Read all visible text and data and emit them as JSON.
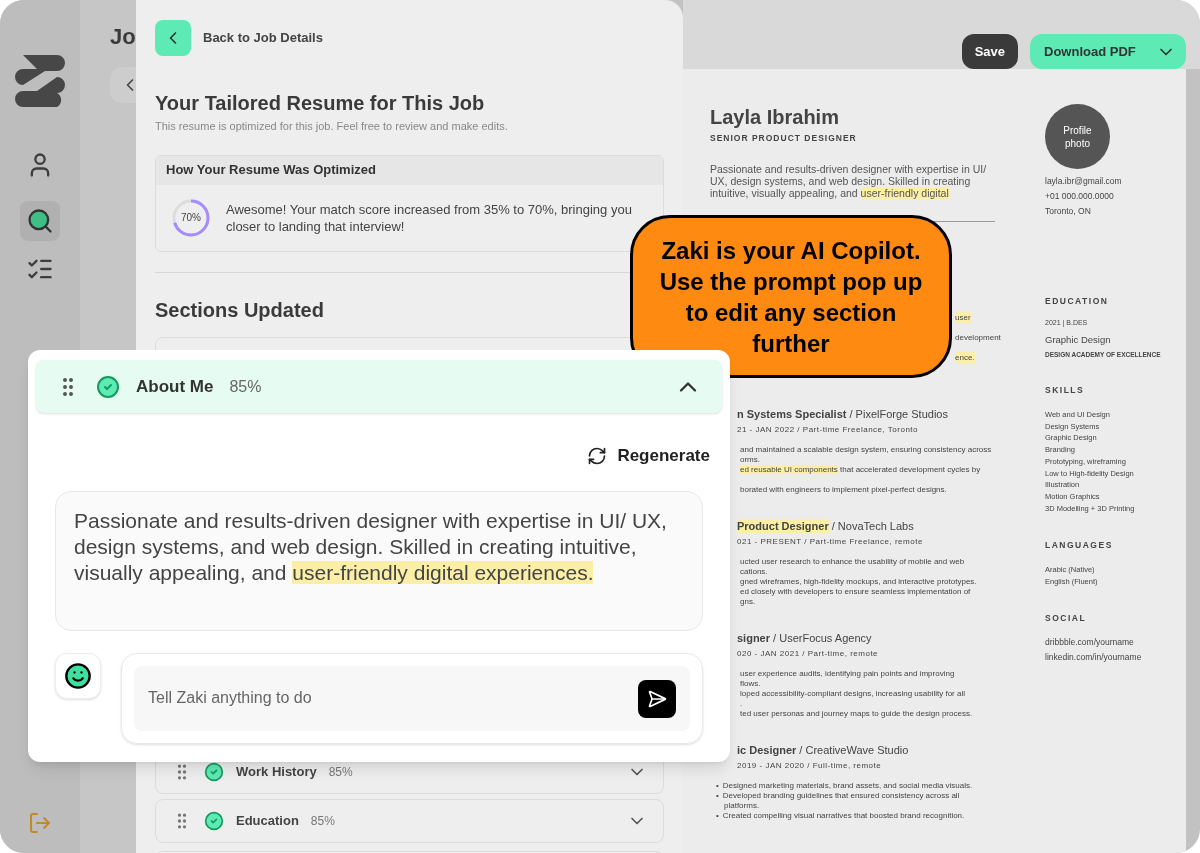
{
  "background_page": {
    "title_fragment": "Jo"
  },
  "back_link": "Back to Job Details",
  "title": "Your Tailored Resume for This Job",
  "subtitle": "This resume is optimized for this job. Feel free to review and make edits.",
  "optimization": {
    "heading": "How Your Resume Was Optimized",
    "score": {
      "label": "70%",
      "level": 0.7
    },
    "message": "Awesome! Your match score increased from 35% to 70%, bringing you closer to landing that interview!"
  },
  "sections_heading": "Sections Updated",
  "sections": [
    {
      "name": "Work History",
      "score": "85%",
      "done": true,
      "expanded": false
    },
    {
      "name": "Education",
      "score": "85%",
      "done": true,
      "expanded": false
    }
  ],
  "toolbar": {
    "save": "Save",
    "download": "Download PDF"
  },
  "resume": {
    "name": "Layla Ibrahim",
    "role": "SENIOR PRODUCT DESIGNER",
    "about": [
      {
        "text": "Passionate and results-driven designer with expertise in UI/ UX, design systems, and web design. Skilled in creating intuitive, visually appealing, and ",
        "highlighted": false
      },
      {
        "text": "user-friendly digital",
        "highlighted": true
      }
    ],
    "fragments": [
      {
        "text": "user",
        "highlighted": true
      },
      {
        "text": "development",
        "highlighted": false
      },
      {
        "text": "ence.",
        "highlighted": true
      }
    ],
    "jobs": [
      {
        "title": "n Systems Specialist",
        "title_highlighted": false,
        "company": " / PixelForge Studios",
        "dates": "21 - JAN 2022 / Part-time Freelance, Toronto",
        "lines": [
          {
            "kind": "clipped",
            "segments": [
              {
                "text": "and maintained a scalable design system, ensuring consistency across",
                "highlighted": false
              }
            ]
          },
          {
            "kind": "clipped",
            "segments": [
              {
                "text": "orms.",
                "highlighted": false
              }
            ]
          },
          {
            "kind": "clipped",
            "segments": [
              {
                "text": "ed reusable UI components",
                "highlighted": true
              },
              {
                "text": " that accelerated development cycles by",
                "highlighted": false
              }
            ]
          },
          {
            "kind": "gap"
          },
          {
            "kind": "clipped",
            "segments": [
              {
                "text": "borated with engineers to implement pixel-perfect designs.",
                "highlighted": false
              }
            ]
          }
        ]
      },
      {
        "title": "Product Designer",
        "title_highlighted": true,
        "company": " / NovaTech Labs",
        "dates": "021 - PRESENT / Part-time Freelance, remote",
        "lines": [
          {
            "kind": "clipped",
            "segments": [
              {
                "text": "ucted user research to enhance the usability of mobile and web",
                "highlighted": false
              }
            ]
          },
          {
            "kind": "clipped",
            "segments": [
              {
                "text": "cations.",
                "highlighted": false
              }
            ]
          },
          {
            "kind": "clipped",
            "segments": [
              {
                "text": "gned wireframes, high-fidelity mockups, and interactive prototypes.",
                "highlighted": false
              }
            ]
          },
          {
            "kind": "clipped",
            "segments": [
              {
                "text": "ed closely with developers to ensure seamless implementation of",
                "highlighted": false
              }
            ]
          },
          {
            "kind": "clipped",
            "segments": [
              {
                "text": "gns.",
                "highlighted": false
              }
            ]
          }
        ]
      },
      {
        "title": "signer",
        "title_highlighted": false,
        "company": " / UserFocus Agency",
        "dates": "020 - JAN 2021 / Part-time, remote",
        "lines": [
          {
            "kind": "clipped",
            "segments": [
              {
                "text": "user experience audits, identifying pain points and improving",
                "highlighted": false
              }
            ]
          },
          {
            "kind": "clipped",
            "segments": [
              {
                "text": "flows.",
                "highlighted": false
              }
            ]
          },
          {
            "kind": "clipped",
            "segments": [
              {
                "text": "loped accessibility-compliant designs, increasing usability for all",
                "highlighted": false
              }
            ]
          },
          {
            "kind": "clipped",
            "segments": [
              {
                "text": ".",
                "highlighted": false
              }
            ]
          },
          {
            "kind": "clipped",
            "segments": [
              {
                "text": "ted user personas and journey maps to guide the design process.",
                "highlighted": false
              }
            ]
          }
        ]
      },
      {
        "title": "ic Designer",
        "title_highlighted": false,
        "company": " / CreativeWave Studio",
        "dates": "2019 - JAN 2020 / Full-time, remote",
        "lines": [
          {
            "kind": "bullet",
            "bullet": "•",
            "segments": [
              {
                "text": "Designed marketing materials, brand assets, and social media visuals.",
                "highlighted": false
              }
            ]
          },
          {
            "kind": "bullet",
            "bullet": "•",
            "segments": [
              {
                "text": "Developed branding guidelines that ensured consistency across all",
                "highlighted": false
              }
            ]
          },
          {
            "kind": "continuation",
            "segments": [
              {
                "text": "platforms.",
                "highlighted": false
              }
            ]
          },
          {
            "kind": "bullet",
            "bullet": "•",
            "segments": [
              {
                "text": "Created compelling visual narratives that boosted brand recognition.",
                "highlighted": false
              }
            ]
          }
        ]
      }
    ],
    "photo_label": "Profile photo",
    "contact": [
      "layla.ibr@gmail.com",
      "+01 000.000.0000",
      "Toronto, ON"
    ],
    "education": {
      "heading": "EDUCATION",
      "meta": "2021 | B.DES",
      "degree": "Graphic Design",
      "school": "DESIGN ACADEMY OF EXCELLENCE"
    },
    "skills": {
      "heading": "SKILLS",
      "items": [
        "Web and UI Design",
        "Design Systems",
        "Graphic Design",
        "Branding",
        "Prototyping, wireframing",
        "Low to High-fidelity Design",
        "Illustration",
        "Motion Graphics",
        "3D Modelling + 3D Printing"
      ]
    },
    "languages": {
      "heading": "LANGUAGES",
      "items": [
        "Arabic (Native)",
        "English (Fluent)"
      ]
    },
    "social": {
      "heading": "SOCIAL",
      "items": [
        "dribbble.com/yourname",
        "linkedin.com/in/yourname"
      ]
    }
  },
  "editor": {
    "section": {
      "name": "About Me",
      "score": "85%",
      "done": true,
      "expanded": true
    },
    "regenerate": "Regenerate",
    "text": [
      {
        "text": "Passionate and results-driven designer with expertise in UI/ UX, design systems, and web design. Skilled in creating intuitive, visually appealing, and ",
        "highlighted": false
      },
      {
        "text": "user-friendly digital experiences.",
        "highlighted": true
      }
    ],
    "prompt_placeholder": "Tell Zaki anything to do"
  },
  "callout": "Zaki is your AI Copilot. Use the prompt pop up to edit any section further"
}
